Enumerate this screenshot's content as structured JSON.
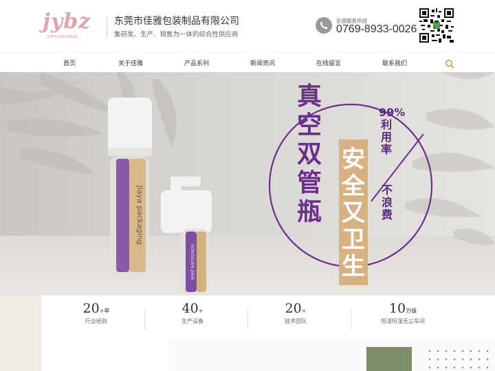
{
  "header": {
    "logo_text": "jybz",
    "logo_sub": "东莞市佳雅包装制品",
    "company_name": "东莞市佳雅包装制品有限公司",
    "slogan": "集研发、生产、销售为一体的综合性供应商",
    "hotline_label": "全国服务热线",
    "hotline_number": "0769-8933-0026"
  },
  "nav": {
    "items": [
      {
        "label": "首页"
      },
      {
        "label": "关于佳雅"
      },
      {
        "label": "产品系列"
      },
      {
        "label": "新闻资讯"
      },
      {
        "label": "在线留言"
      },
      {
        "label": "联系我们"
      }
    ]
  },
  "banner": {
    "headline": "真空双管瓶",
    "gold_text": "安全又卫生",
    "side_text_a": "99%利用率",
    "side_text_b": "不浪费",
    "bottle_brand": "Jiaya packaging",
    "small_bottle_brand": "DONGGUAN JIAYA",
    "colors": {
      "purple": "#6b2f8a",
      "gold": "#d8b182"
    }
  },
  "stats": [
    {
      "value": "20",
      "suffix": "+年",
      "label": "行业经验"
    },
    {
      "value": "40",
      "suffix": "+",
      "label": "生产设备"
    },
    {
      "value": "20",
      "suffix": "+",
      "label": "技术团队"
    },
    {
      "value": "10",
      "suffix": "万级",
      "label": "恒温恒湿无尘车间"
    }
  ],
  "icons": {
    "phone": "phone-icon",
    "search": "search-icon",
    "qr": "qr-code-icon"
  }
}
